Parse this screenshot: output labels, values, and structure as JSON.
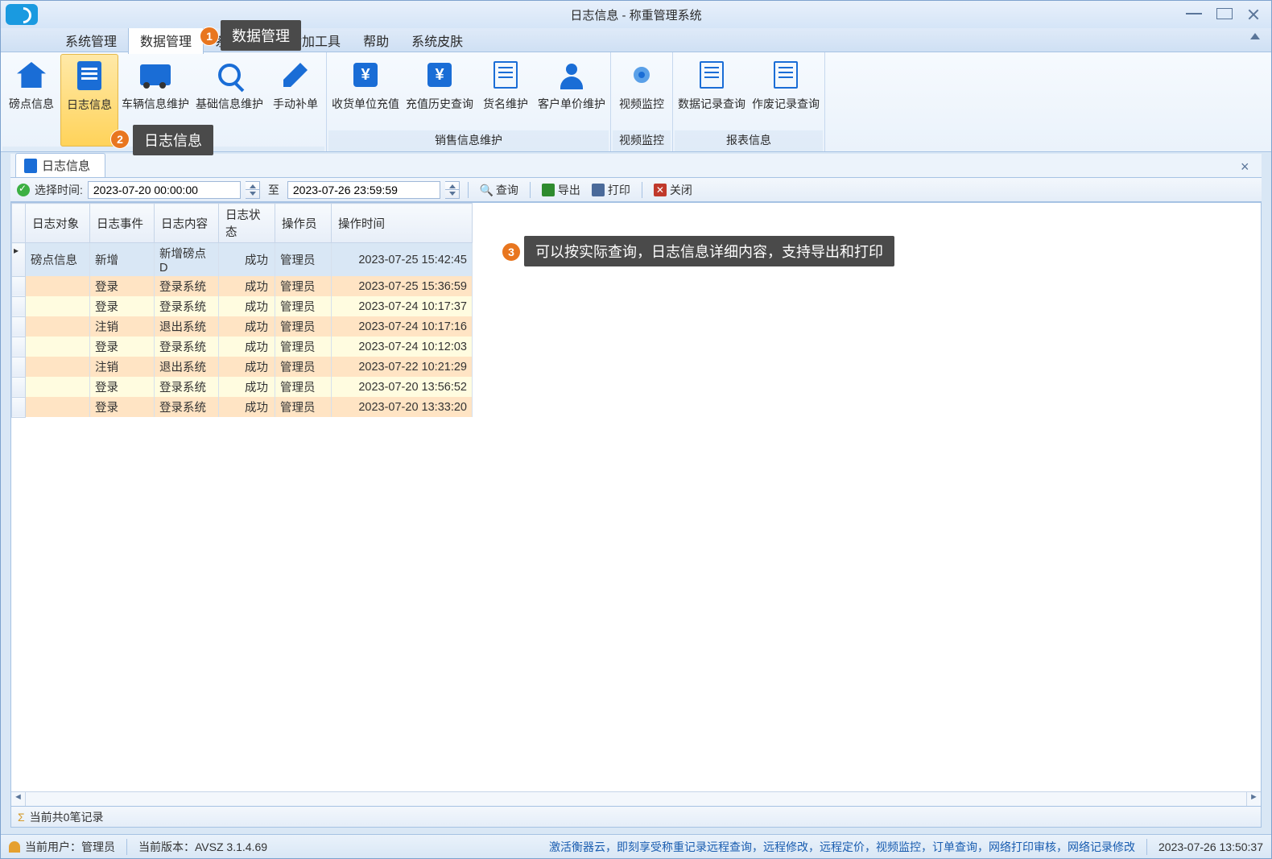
{
  "window": {
    "title": "日志信息 - 称重管理系统"
  },
  "menu": {
    "items": [
      "系统管理",
      "数据管理",
      "系统维护",
      "附加工具",
      "帮助",
      "系统皮肤"
    ],
    "active_index": 1
  },
  "ribbon": {
    "groups": [
      {
        "label": "",
        "buttons": [
          {
            "label": "磅点信息",
            "icon": "home"
          },
          {
            "label": "日志信息",
            "icon": "doc",
            "active": true
          },
          {
            "label": "车辆信息维护",
            "icon": "truck"
          },
          {
            "label": "基础信息维护",
            "icon": "mag"
          },
          {
            "label": "手动补单",
            "icon": "pen"
          }
        ]
      },
      {
        "label": "销售信息维护",
        "buttons": [
          {
            "label": "收货单位充值",
            "icon": "yen"
          },
          {
            "label": "充值历史查询",
            "icon": "yen"
          },
          {
            "label": "货名维护",
            "icon": "list"
          },
          {
            "label": "客户单价维护",
            "icon": "user"
          }
        ]
      },
      {
        "label": "视频监控",
        "buttons": [
          {
            "label": "视频监控",
            "icon": "cam"
          }
        ]
      },
      {
        "label": "报表信息",
        "buttons": [
          {
            "label": "数据记录查询",
            "icon": "list"
          },
          {
            "label": "作废记录查询",
            "icon": "list"
          }
        ]
      }
    ]
  },
  "doc_tab": {
    "label": "日志信息"
  },
  "toolbar": {
    "time_label": "选择时间:",
    "from": "2023-07-20 00:00:00",
    "to_label": "至",
    "to": "2023-07-26 23:59:59",
    "query": "查询",
    "export": "导出",
    "print": "打印",
    "close": "关闭"
  },
  "grid": {
    "columns": [
      "日志对象",
      "日志事件",
      "日志内容",
      "日志状态",
      "操作员",
      "操作时间"
    ],
    "rows": [
      {
        "cls": "selected",
        "cells": [
          "磅点信息",
          "新增",
          "新增磅点D",
          "成功",
          "管理员",
          "2023-07-25 15:42:45"
        ]
      },
      {
        "cls": "r-orange",
        "cells": [
          "",
          "登录",
          "登录系统",
          "成功",
          "管理员",
          "2023-07-25 15:36:59"
        ]
      },
      {
        "cls": "r-yellow",
        "cells": [
          "",
          "登录",
          "登录系统",
          "成功",
          "管理员",
          "2023-07-24 10:17:37"
        ]
      },
      {
        "cls": "r-orange",
        "cells": [
          "",
          "注销",
          "退出系统",
          "成功",
          "管理员",
          "2023-07-24 10:17:16"
        ]
      },
      {
        "cls": "r-yellow",
        "cells": [
          "",
          "登录",
          "登录系统",
          "成功",
          "管理员",
          "2023-07-24 10:12:03"
        ]
      },
      {
        "cls": "r-orange",
        "cells": [
          "",
          "注销",
          "退出系统",
          "成功",
          "管理员",
          "2023-07-22 10:21:29"
        ]
      },
      {
        "cls": "r-yellow",
        "cells": [
          "",
          "登录",
          "登录系统",
          "成功",
          "管理员",
          "2023-07-20 13:56:52"
        ]
      },
      {
        "cls": "r-orange",
        "cells": [
          "",
          "登录",
          "登录系统",
          "成功",
          "管理员",
          "2023-07-20 13:33:20"
        ]
      }
    ],
    "footer": "当前共0笔记录"
  },
  "status": {
    "user_label": "当前用户：管理员",
    "version_label": "当前版本：AVSZ 3.1.4.69",
    "marquee": "激活衡器云，即刻享受称重记录远程查询，远程修改，远程定价，视频监控，订单查询，网络打印审核，网络记录修改",
    "datetime": "2023-07-26 13:50:37"
  },
  "annotations": {
    "a1": "数据管理",
    "a2": "日志信息",
    "a3": "可以按实际查询，日志信息详细内容，支持导出和打印"
  }
}
